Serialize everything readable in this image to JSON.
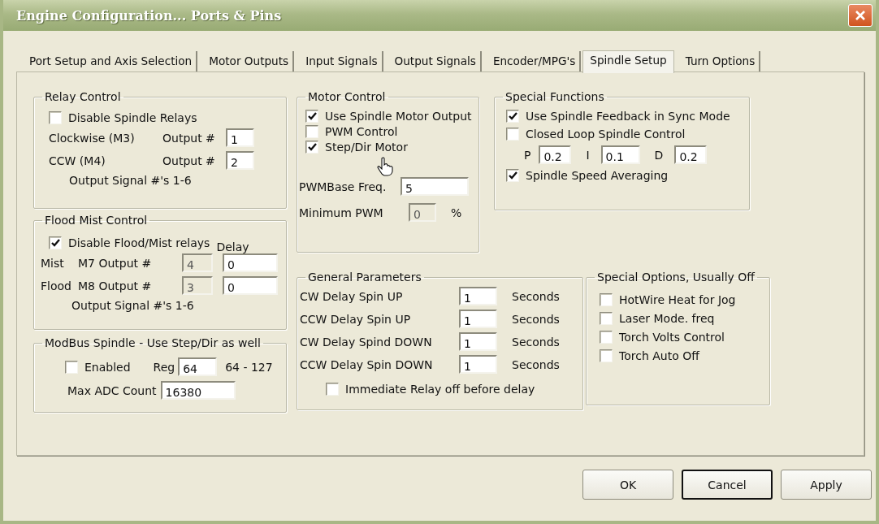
{
  "window": {
    "title": "Engine Configuration... Ports & Pins"
  },
  "tabs": [
    {
      "label": "Port Setup and Axis Selection",
      "selected": false
    },
    {
      "label": "Motor Outputs",
      "selected": false
    },
    {
      "label": "Input Signals",
      "selected": false
    },
    {
      "label": "Output Signals",
      "selected": false
    },
    {
      "label": "Encoder/MPG's",
      "selected": false
    },
    {
      "label": "Spindle Setup",
      "selected": true
    },
    {
      "label": "Turn Options",
      "selected": false
    }
  ],
  "relay_control": {
    "title": "Relay Control",
    "disable_spindle_relays": {
      "label": "Disable Spindle Relays",
      "checked": false
    },
    "rows": [
      {
        "label": "Clockwise (M3)",
        "output_label": "Output #",
        "value": "1"
      },
      {
        "label": "CCW (M4)",
        "output_label": "Output #",
        "value": "2"
      }
    ],
    "note": "Output Signal #'s 1-6"
  },
  "flood_mist_control": {
    "title": "Flood Mist Control",
    "disable_relays": {
      "label": "Disable Flood/Mist relays",
      "checked": true
    },
    "delay_label": "Delay",
    "rows": [
      {
        "name": "Mist",
        "output_label": "M7 Output #",
        "output": "4",
        "output_disabled": true,
        "delay": "0"
      },
      {
        "name": "Flood",
        "output_label": "M8 Output #",
        "output": "3",
        "output_disabled": true,
        "delay": "0"
      }
    ],
    "note": "Output Signal #'s 1-6"
  },
  "modbus_spindle": {
    "title": "ModBus Spindle - Use Step/Dir as well",
    "enabled": {
      "label": "Enabled",
      "checked": false
    },
    "reg_label": "Reg",
    "reg": "64",
    "reg_range": "64 - 127",
    "max_adc_label": "Max ADC Count",
    "max_adc": "16380"
  },
  "motor_control": {
    "title": "Motor Control",
    "options": [
      {
        "label": "Use Spindle Motor Output",
        "checked": true
      },
      {
        "label": "PWM Control",
        "checked": false
      },
      {
        "label": "Step/Dir Motor",
        "checked": true
      }
    ],
    "pwm_base_freq": {
      "label": "PWMBase Freq.",
      "value": "5"
    },
    "minimum_pwm": {
      "label": "Minimum PWM",
      "value": "0",
      "disabled": true,
      "unit": "%"
    }
  },
  "special_functions": {
    "title": "Special Functions",
    "items": [
      {
        "kind": "checkbox",
        "label": "Use Spindle Feedback in Sync Mode",
        "checked": true
      },
      {
        "kind": "checkbox",
        "label": "Closed Loop Spindle Control",
        "checked": false
      },
      {
        "kind": "pid",
        "fields": [
          {
            "label": "P",
            "value": "0.2"
          },
          {
            "label": "I",
            "value": "0.1"
          },
          {
            "label": "D",
            "value": "0.2"
          }
        ]
      },
      {
        "kind": "checkbox",
        "label": "Spindle Speed Averaging",
        "checked": true
      }
    ]
  },
  "general_parameters": {
    "title": "General Parameters",
    "rows": [
      {
        "label": "CW Delay Spin UP",
        "value": "1",
        "unit": "Seconds"
      },
      {
        "label": "CCW Delay Spin UP",
        "value": "1",
        "unit": "Seconds"
      },
      {
        "label": "CW Delay Spind DOWN",
        "value": "1",
        "unit": "Seconds"
      },
      {
        "label": "CCW Delay Spin DOWN",
        "value": "1",
        "unit": "Seconds"
      }
    ],
    "immediate_relay_off": {
      "label": "Immediate Relay off before delay",
      "checked": false
    }
  },
  "special_options": {
    "title": "Special Options, Usually Off",
    "options": [
      {
        "label": "HotWire Heat for Jog",
        "checked": false
      },
      {
        "label": "Laser Mode. freq",
        "checked": false
      },
      {
        "label": "Torch Volts Control",
        "checked": false
      },
      {
        "label": "Torch Auto Off",
        "checked": false
      }
    ]
  },
  "buttons": [
    {
      "label": "OK",
      "focused": false
    },
    {
      "label": "Cancel",
      "focused": true
    },
    {
      "label": "Apply",
      "focused": false
    }
  ]
}
